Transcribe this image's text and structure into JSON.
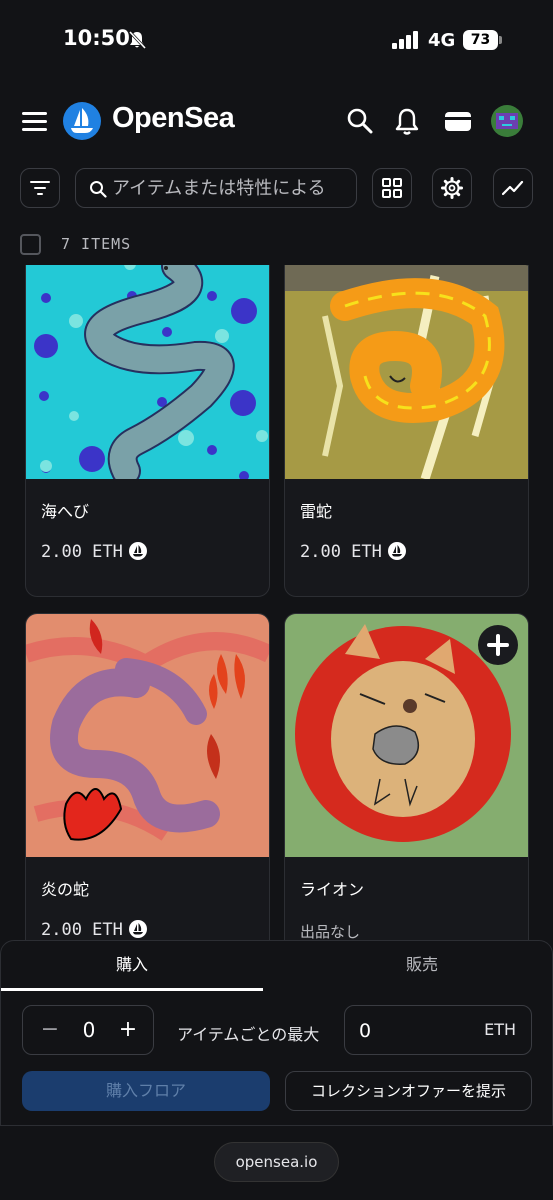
{
  "status_bar": {
    "time": "10:50",
    "network": "4G",
    "battery": "73"
  },
  "header": {
    "brand": "OpenSea"
  },
  "toolbar": {
    "search_placeholder": "アイテムまたは特性による"
  },
  "items": {
    "count_label": "7 ITEMS"
  },
  "cards": [
    {
      "name": "海へび",
      "price": "2.00 ETH",
      "art": "sea-serpent"
    },
    {
      "name": "雷蛇",
      "price": "2.00 ETH",
      "art": "thunder-snake"
    },
    {
      "name": "炎の蛇",
      "price": "2.00 ETH",
      "art": "fire-snake"
    },
    {
      "name": "ライオン",
      "price": "出品なし",
      "art": "lion"
    }
  ],
  "panel": {
    "tabs": [
      "購入",
      "販売"
    ],
    "active_tab": "購入",
    "quantity": "0",
    "minus": "−",
    "plus": "+",
    "max_label": "アイテムごとの最大",
    "max_value": "0",
    "max_unit": "ETH",
    "buy_floor": "購入フロア",
    "collection_offer": "コレクションオファーを提示"
  },
  "browser": {
    "url": "opensea.io"
  },
  "colors": {
    "background": "#121316",
    "brand_blue": "#2081e2",
    "disabled_button": "#1b3d6e"
  }
}
